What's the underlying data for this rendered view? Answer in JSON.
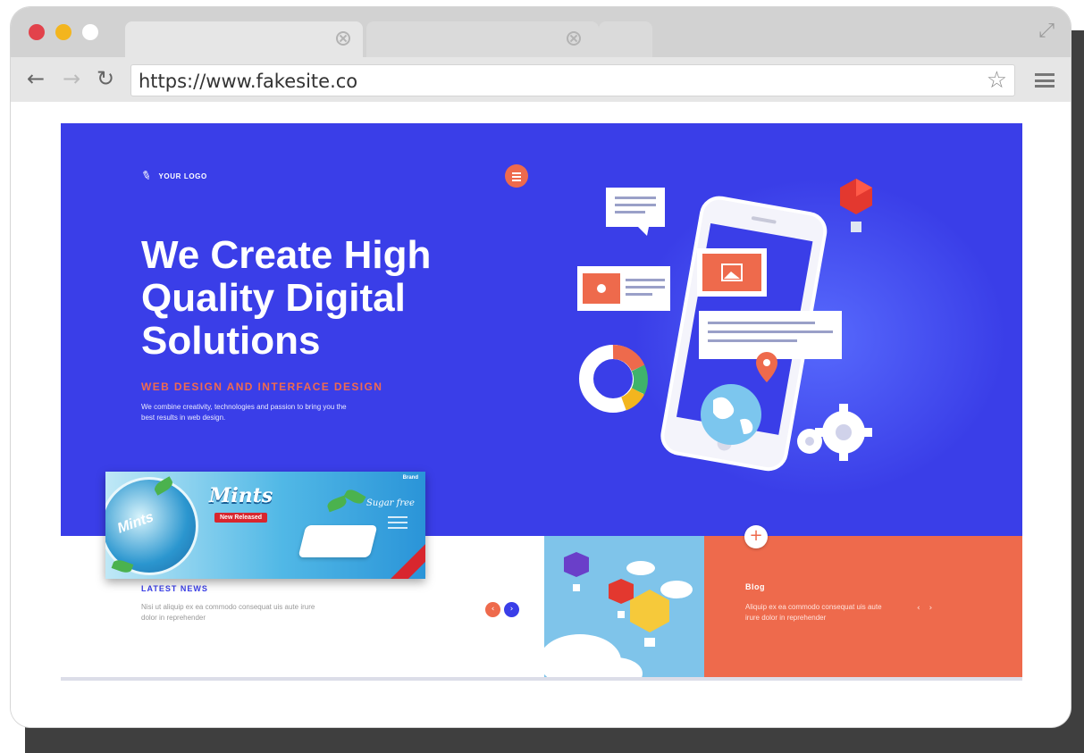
{
  "browser": {
    "url": "https://www.fakesite.co",
    "traffic_lights": [
      "#e2424b",
      "#f3b51e",
      "#ffffff"
    ],
    "icons": {
      "back": "back-arrow-icon",
      "forward": "forward-arrow-icon",
      "reload": "reload-icon",
      "bookmark": "star-icon",
      "menu": "hamburger-menu-icon",
      "expand": "expand-icon"
    }
  },
  "hero": {
    "logo_text": "YOUR LOGO",
    "headline": "We Create High Quality Digital Solutions",
    "subtitle": "WEB DESIGN AND INTERFACE DESIGN",
    "description": "We combine creativity, technologies and passion to bring you the best results in web design.",
    "colors": {
      "background": "#3a3ee8",
      "accent": "#ee6a4c"
    }
  },
  "ad": {
    "tin_label": "Mints",
    "title": "Mints",
    "badge": "New Released",
    "tagline": "Sugar free",
    "brand": "Brand"
  },
  "news": {
    "title": "LATEST NEWS",
    "text": "Nisi ut aliquip ex ea commodo consequat uis aute irure dolor in reprehender"
  },
  "blog": {
    "title": "Blog",
    "text": "Aliquip ex ea commodo consequat uis aute irure dolor in reprehender",
    "color": "#ee6a4c"
  }
}
